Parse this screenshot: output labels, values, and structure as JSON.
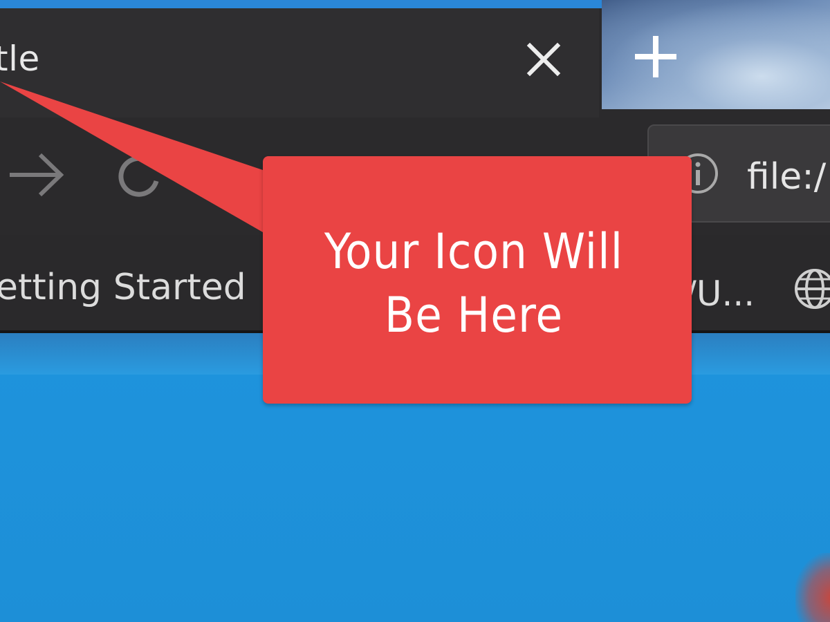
{
  "tab": {
    "title": "tle",
    "close_icon": "close-icon"
  },
  "new_tab": {
    "icon": "plus-icon"
  },
  "toolbar": {
    "forward_icon": "arrow-right-icon",
    "reload_icon": "reload-icon",
    "url_info_icon": "info-icon",
    "url": "file:/"
  },
  "bookmarks": {
    "items": [
      {
        "label": "etting Started"
      },
      {
        "label": "/U..."
      }
    ],
    "globe_icon": "globe-icon"
  },
  "callout": {
    "line1": "Your Icon Will",
    "line2": "Be Here",
    "color": "#ea4444"
  },
  "colors": {
    "tab_bg": "#2f2e30",
    "toolbar_bg": "#2b2a2c",
    "page_bg": "#1f8fd6",
    "accent": "#2a87d8"
  }
}
